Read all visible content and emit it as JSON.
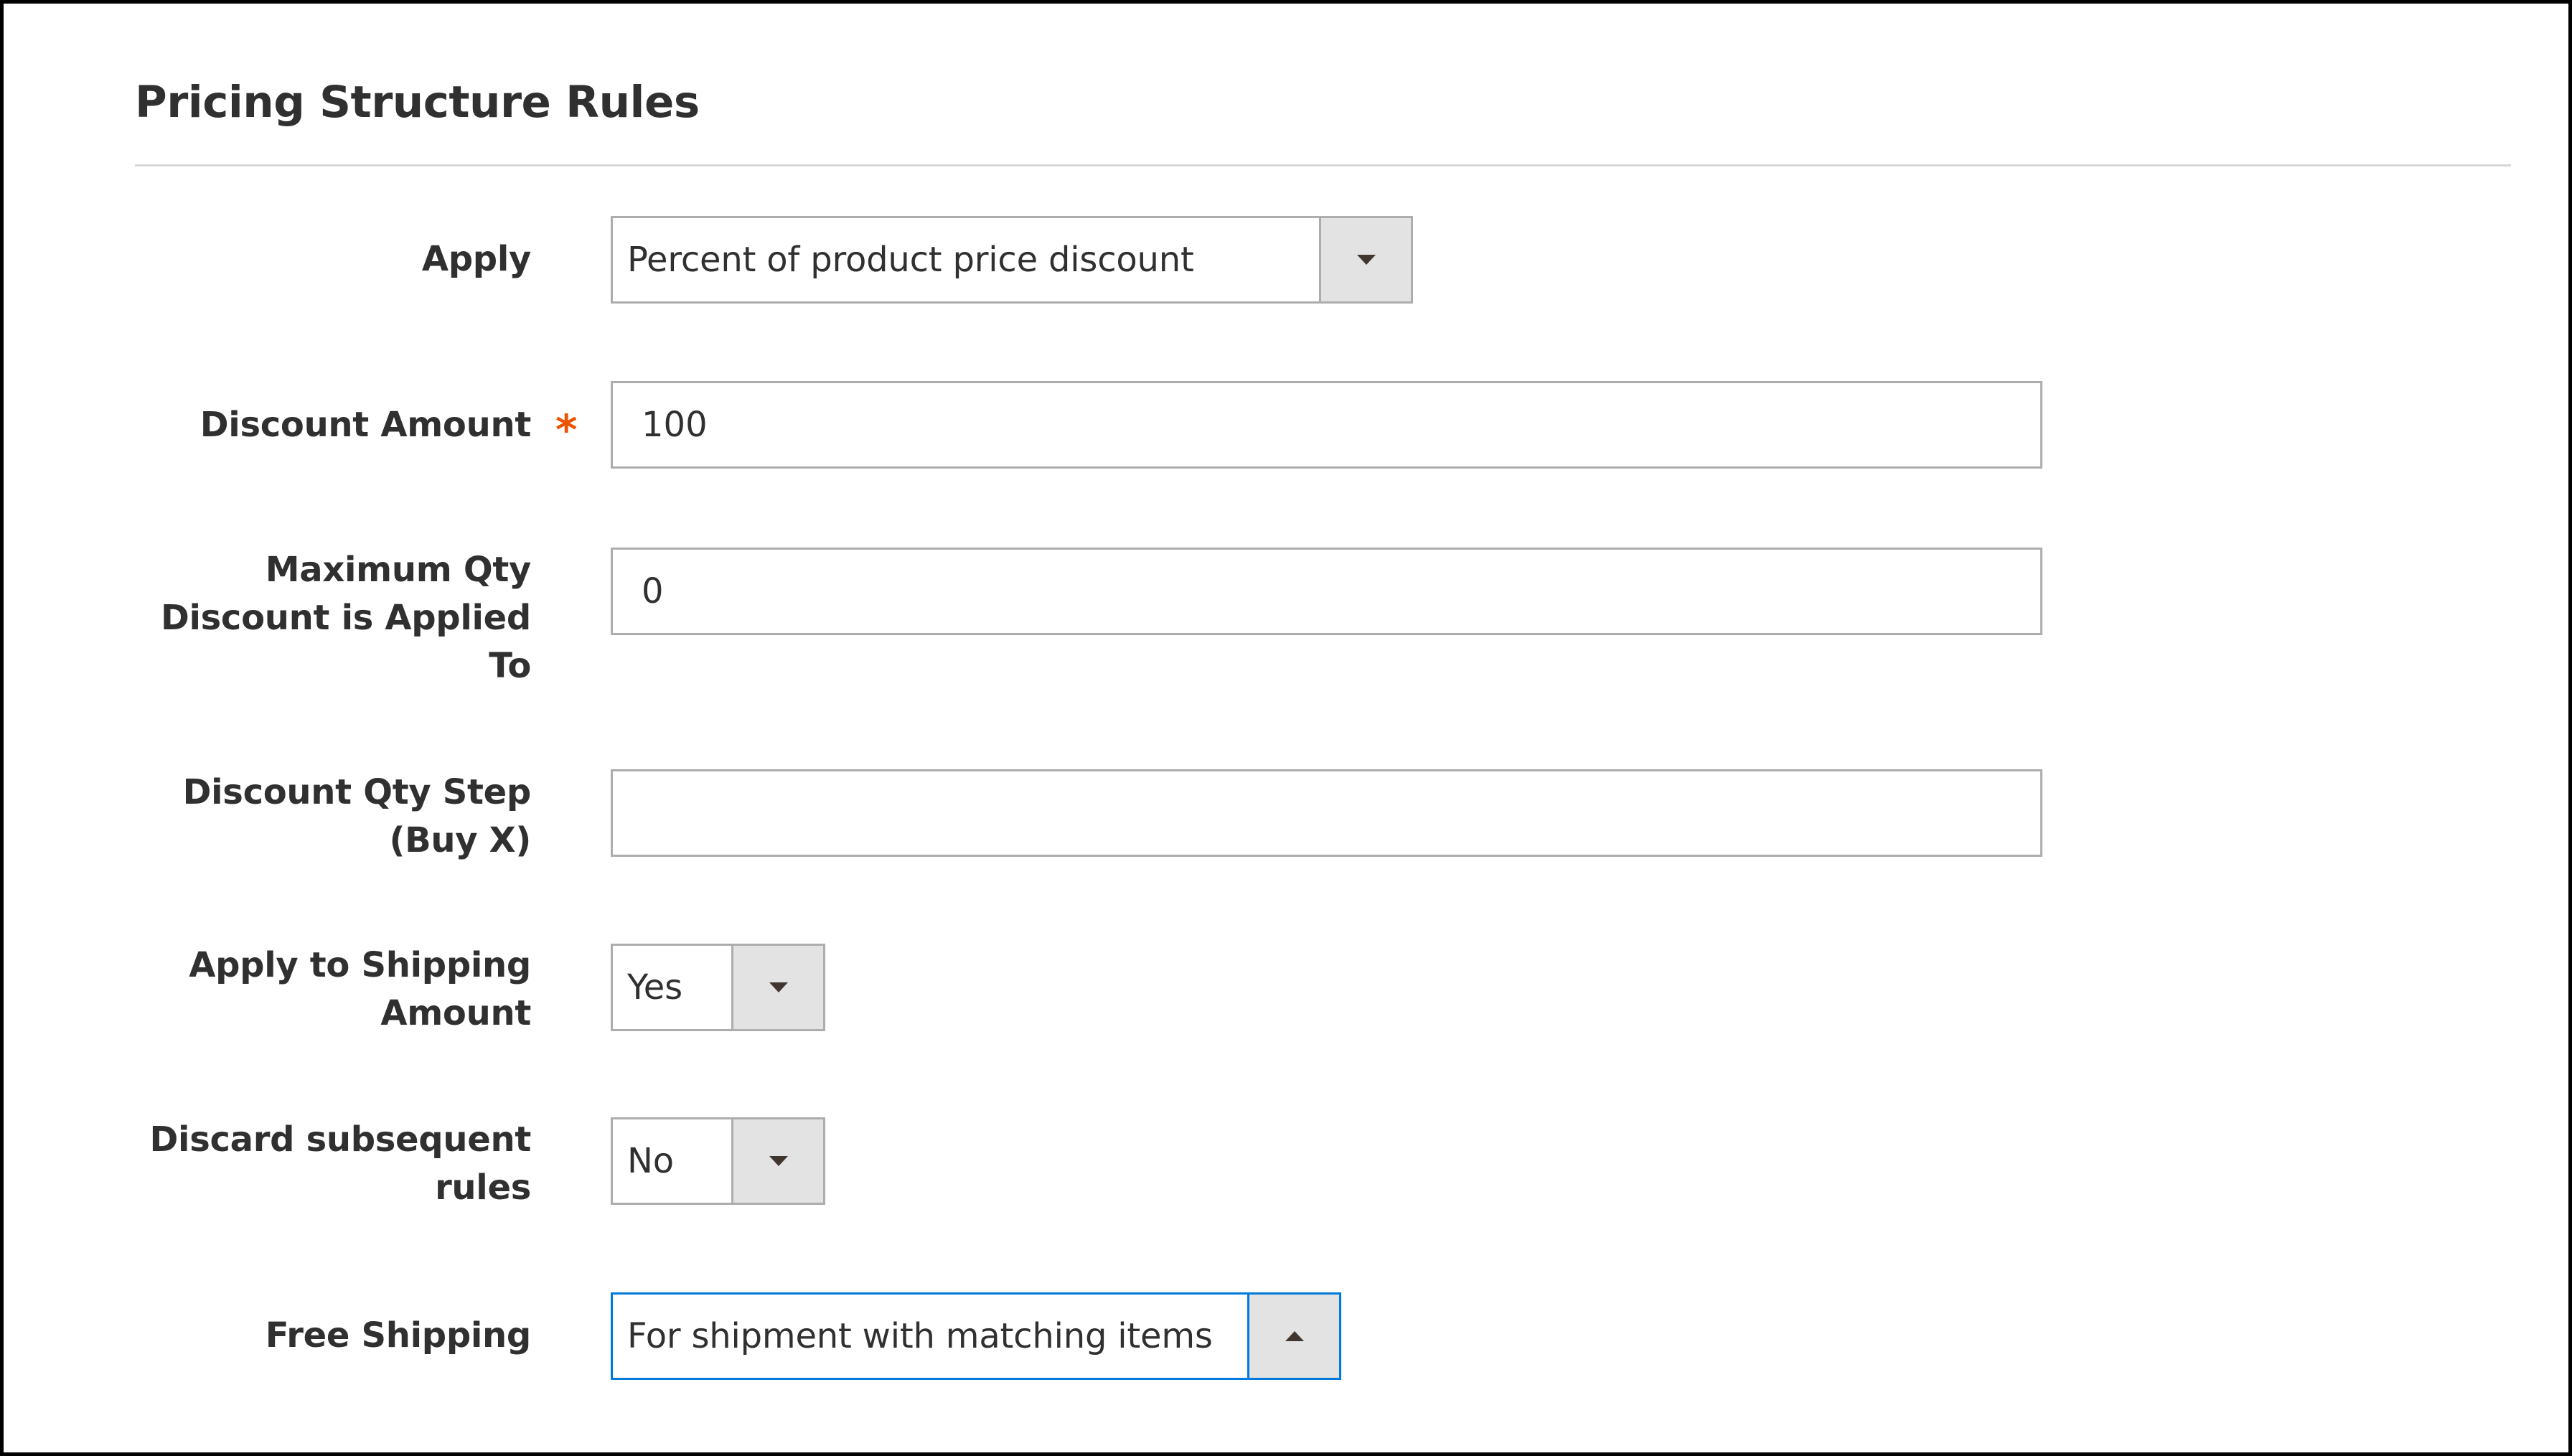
{
  "section": {
    "title": "Pricing Structure Rules"
  },
  "fields": {
    "apply": {
      "label": "Apply",
      "value": "Percent of product price discount"
    },
    "discount_amount": {
      "label": "Discount Amount",
      "required_mark": "*",
      "value": "100"
    },
    "max_qty": {
      "label_lines": [
        "Maximum Qty",
        "Discount is Applied",
        "To"
      ],
      "value": "0"
    },
    "discount_step": {
      "label_lines": [
        "Discount Qty Step",
        "(Buy X)"
      ],
      "value": ""
    },
    "apply_shipping": {
      "label_lines": [
        "Apply to Shipping",
        "Amount"
      ],
      "value": "Yes"
    },
    "discard_rules": {
      "label_lines": [
        "Discard subsequent",
        "rules"
      ],
      "value": "No"
    },
    "free_shipping": {
      "label": "Free Shipping",
      "value": "For shipment with matching items"
    }
  },
  "icons": {
    "select_closed": "chevron-down-icon",
    "select_open": "chevron-up-icon"
  },
  "colors": {
    "required": "#eb5202",
    "focus_border": "#007bdb",
    "border": "#adadad",
    "dropdown_button": "#e3e3e3"
  }
}
